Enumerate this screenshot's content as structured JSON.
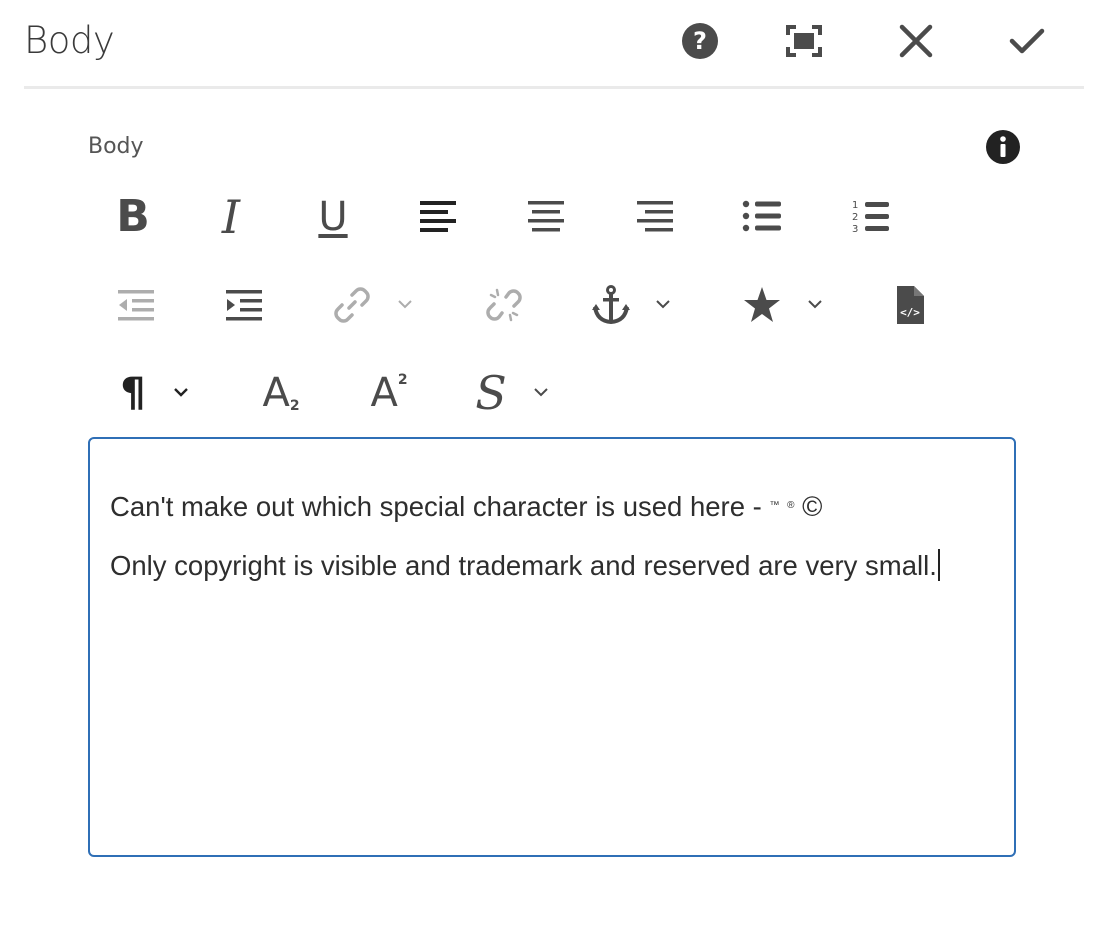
{
  "header": {
    "title": "Body"
  },
  "field": {
    "label": "Body"
  },
  "toolbar": {
    "bold_glyph": "B",
    "italic_glyph": "I",
    "underline_glyph": "U",
    "paragraph_glyph": "¶",
    "subscript_glyph": "A",
    "subscript_mark": "2",
    "superscript_glyph": "A",
    "superscript_mark": "2",
    "styles_glyph": "S"
  },
  "editor": {
    "line1_text": "Can't make out which special character is used here - ",
    "line1_tm": "™",
    "line1_reg": "®",
    "line1_copy": "©",
    "line2_text": "Only copyright is visible and trademark and reserved are very small."
  },
  "colors": {
    "icon": "#4b4b4b",
    "disabled_icon": "#9a9a9a",
    "editor_border": "#2f6fb6",
    "divider": "#eaeaea"
  }
}
